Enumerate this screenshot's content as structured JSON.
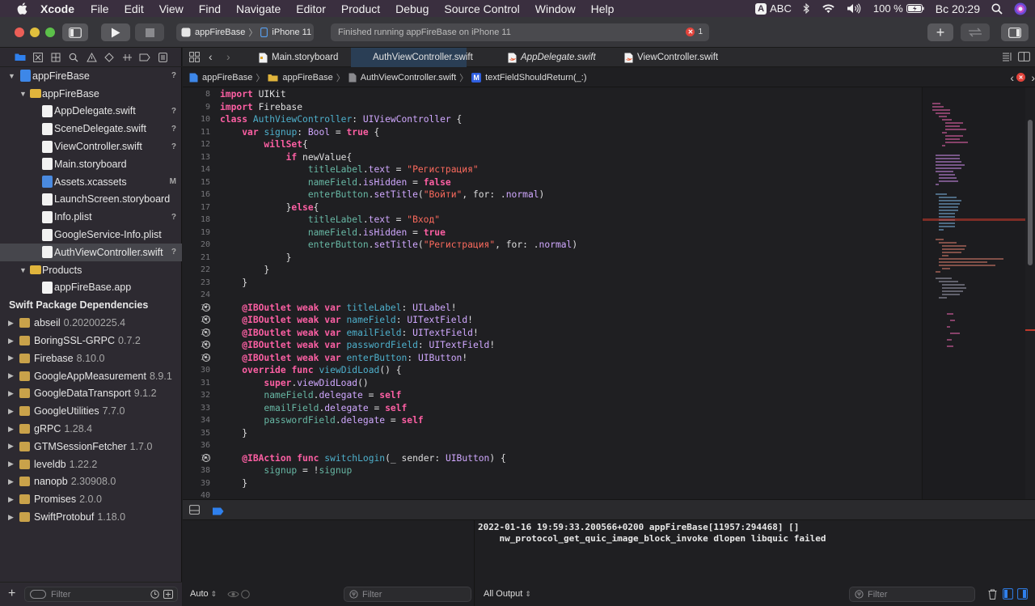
{
  "menubar": {
    "app": "Xcode",
    "items": [
      "File",
      "Edit",
      "View",
      "Find",
      "Navigate",
      "Editor",
      "Product",
      "Debug",
      "Source Control",
      "Window",
      "Help"
    ],
    "input_source": "ABC",
    "battery": "100 %",
    "clock": "Вс 20:29"
  },
  "toolbar": {
    "scheme": "appFireBase",
    "device": "iPhone 11",
    "status": "Finished running appFireBase on iPhone 11",
    "error_count": "1"
  },
  "navigator": {
    "tree": [
      {
        "label": "appFireBase",
        "level": 0,
        "type": "project",
        "status": "?",
        "expanded": true
      },
      {
        "label": "appFireBase",
        "level": 1,
        "type": "folder",
        "status": "",
        "expanded": true
      },
      {
        "label": "AppDelegate.swift",
        "level": 2,
        "type": "swift",
        "status": "?"
      },
      {
        "label": "SceneDelegate.swift",
        "level": 2,
        "type": "swift",
        "status": "?"
      },
      {
        "label": "ViewController.swift",
        "level": 2,
        "type": "swift",
        "status": "?"
      },
      {
        "label": "Main.storyboard",
        "level": 2,
        "type": "storyboard",
        "status": ""
      },
      {
        "label": "Assets.xcassets",
        "level": 2,
        "type": "assets",
        "status": "M"
      },
      {
        "label": "LaunchScreen.storyboard",
        "level": 2,
        "type": "storyboard",
        "status": ""
      },
      {
        "label": "Info.plist",
        "level": 2,
        "type": "plist",
        "status": "?"
      },
      {
        "label": "GoogleService-Info.plist",
        "level": 2,
        "type": "plist",
        "status": ""
      },
      {
        "label": "AuthViewController.swift",
        "level": 2,
        "type": "swift",
        "status": "?",
        "selected": true
      },
      {
        "label": "Products",
        "level": 1,
        "type": "folder",
        "status": "",
        "expanded": true
      },
      {
        "label": "appFireBase.app",
        "level": 2,
        "type": "app",
        "status": ""
      }
    ],
    "packages_header": "Swift Package Dependencies",
    "packages": [
      {
        "name": "abseil",
        "version": "0.20200225.4"
      },
      {
        "name": "BoringSSL-GRPC",
        "version": "0.7.2"
      },
      {
        "name": "Firebase",
        "version": "8.10.0"
      },
      {
        "name": "GoogleAppMeasurement",
        "version": "8.9.1"
      },
      {
        "name": "GoogleDataTransport",
        "version": "9.1.2"
      },
      {
        "name": "GoogleUtilities",
        "version": "7.7.0"
      },
      {
        "name": "gRPC",
        "version": "1.28.4"
      },
      {
        "name": "GTMSessionFetcher",
        "version": "1.7.0"
      },
      {
        "name": "leveldb",
        "version": "1.22.2"
      },
      {
        "name": "nanopb",
        "version": "2.30908.0"
      },
      {
        "name": "Promises",
        "version": "2.0.0"
      },
      {
        "name": "SwiftProtobuf",
        "version": "1.18.0"
      }
    ],
    "filter_placeholder": "Filter"
  },
  "tabs": [
    {
      "label": "Main.storyboard",
      "italic": false,
      "active": false
    },
    {
      "label": "AuthViewController.swift",
      "italic": false,
      "active": true
    },
    {
      "label": "AppDelegate.swift",
      "italic": true,
      "active": false
    },
    {
      "label": "ViewController.swift",
      "italic": false,
      "active": false
    }
  ],
  "jumpbar": {
    "project": "appFireBase",
    "group": "appFireBase",
    "file": "AuthViewController.swift",
    "symbol_badge": "M",
    "symbol": "textFieldShouldReturn(_:)"
  },
  "code": [
    {
      "n": "8",
      "o": false,
      "t": [
        [
          "kw",
          "import"
        ],
        [
          "pl",
          " UIKit"
        ]
      ]
    },
    {
      "n": "9",
      "o": false,
      "t": [
        [
          "kw",
          "import"
        ],
        [
          "pl",
          " Firebase"
        ]
      ]
    },
    {
      "n": "10",
      "o": false,
      "t": [
        [
          "kw",
          "class"
        ],
        [
          "pl",
          " "
        ],
        [
          "id",
          "AuthViewController"
        ],
        [
          "pl",
          ": "
        ],
        [
          "ty",
          "UIViewController"
        ],
        [
          "pl",
          " {"
        ]
      ]
    },
    {
      "n": "11",
      "o": false,
      "t": [
        [
          "pl",
          "    "
        ],
        [
          "kw",
          "var"
        ],
        [
          "pl",
          " "
        ],
        [
          "id",
          "signup"
        ],
        [
          "pl",
          ": "
        ],
        [
          "ty",
          "Bool"
        ],
        [
          "pl",
          " = "
        ],
        [
          "kw",
          "true"
        ],
        [
          "pl",
          " {"
        ]
      ]
    },
    {
      "n": "12",
      "o": false,
      "t": [
        [
          "pl",
          "        "
        ],
        [
          "kw",
          "willSet"
        ],
        [
          "pl",
          "{"
        ]
      ]
    },
    {
      "n": "13",
      "o": false,
      "t": [
        [
          "pl",
          "            "
        ],
        [
          "kw",
          "if"
        ],
        [
          "pl",
          " newValue{"
        ]
      ]
    },
    {
      "n": "14",
      "o": false,
      "t": [
        [
          "pl",
          "                "
        ],
        [
          "fn",
          "titleLabel"
        ],
        [
          "pl",
          "."
        ],
        [
          "ty",
          "text"
        ],
        [
          "pl",
          " = "
        ],
        [
          "st2",
          "\"Регистрация\""
        ]
      ]
    },
    {
      "n": "15",
      "o": false,
      "t": [
        [
          "pl",
          "                "
        ],
        [
          "fn",
          "nameField"
        ],
        [
          "pl",
          "."
        ],
        [
          "ty",
          "isHidden"
        ],
        [
          "pl",
          " = "
        ],
        [
          "kw",
          "false"
        ]
      ]
    },
    {
      "n": "16",
      "o": false,
      "t": [
        [
          "pl",
          "                "
        ],
        [
          "fn",
          "enterButton"
        ],
        [
          "pl",
          "."
        ],
        [
          "ty",
          "setTitle"
        ],
        [
          "pl",
          "("
        ],
        [
          "st2",
          "\"Войти\""
        ],
        [
          "pl",
          ", for: ."
        ],
        [
          "ty",
          "normal"
        ],
        [
          "pl",
          ")"
        ]
      ]
    },
    {
      "n": "17",
      "o": false,
      "t": [
        [
          "pl",
          "            }"
        ],
        [
          "kw",
          "else"
        ],
        [
          "pl",
          "{"
        ]
      ]
    },
    {
      "n": "18",
      "o": false,
      "t": [
        [
          "pl",
          "                "
        ],
        [
          "fn",
          "titleLabel"
        ],
        [
          "pl",
          "."
        ],
        [
          "ty",
          "text"
        ],
        [
          "pl",
          " = "
        ],
        [
          "st2",
          "\"Вход\""
        ]
      ]
    },
    {
      "n": "19",
      "o": false,
      "t": [
        [
          "pl",
          "                "
        ],
        [
          "fn",
          "nameField"
        ],
        [
          "pl",
          "."
        ],
        [
          "ty",
          "isHidden"
        ],
        [
          "pl",
          " = "
        ],
        [
          "kw",
          "true"
        ]
      ]
    },
    {
      "n": "20",
      "o": false,
      "t": [
        [
          "pl",
          "                "
        ],
        [
          "fn",
          "enterButton"
        ],
        [
          "pl",
          "."
        ],
        [
          "ty",
          "setTitle"
        ],
        [
          "pl",
          "("
        ],
        [
          "st2",
          "\"Регистрация\""
        ],
        [
          "pl",
          ", for: ."
        ],
        [
          "ty",
          "normal"
        ],
        [
          "pl",
          ")"
        ]
      ]
    },
    {
      "n": "21",
      "o": false,
      "t": [
        [
          "pl",
          "            }"
        ]
      ]
    },
    {
      "n": "22",
      "o": false,
      "t": [
        [
          "pl",
          "        }"
        ]
      ]
    },
    {
      "n": "23",
      "o": false,
      "t": [
        [
          "pl",
          "    }"
        ]
      ]
    },
    {
      "n": "24",
      "o": false,
      "t": [
        [
          "pl",
          ""
        ]
      ]
    },
    {
      "n": "25",
      "o": true,
      "t": [
        [
          "pl",
          "    "
        ],
        [
          "kw",
          "@IBOutlet"
        ],
        [
          "pl",
          " "
        ],
        [
          "kw",
          "weak"
        ],
        [
          "pl",
          " "
        ],
        [
          "kw",
          "var"
        ],
        [
          "pl",
          " "
        ],
        [
          "id",
          "titleLabel"
        ],
        [
          "pl",
          ": "
        ],
        [
          "ty",
          "UILabel"
        ],
        [
          "pl",
          "!"
        ]
      ]
    },
    {
      "n": "26",
      "o": true,
      "t": [
        [
          "pl",
          "    "
        ],
        [
          "kw",
          "@IBOutlet"
        ],
        [
          "pl",
          " "
        ],
        [
          "kw",
          "weak"
        ],
        [
          "pl",
          " "
        ],
        [
          "kw",
          "var"
        ],
        [
          "pl",
          " "
        ],
        [
          "id",
          "nameField"
        ],
        [
          "pl",
          ": "
        ],
        [
          "ty",
          "UITextField"
        ],
        [
          "pl",
          "!"
        ]
      ]
    },
    {
      "n": "27",
      "o": true,
      "t": [
        [
          "pl",
          "    "
        ],
        [
          "kw",
          "@IBOutlet"
        ],
        [
          "pl",
          " "
        ],
        [
          "kw",
          "weak"
        ],
        [
          "pl",
          " "
        ],
        [
          "kw",
          "var"
        ],
        [
          "pl",
          " "
        ],
        [
          "id",
          "emailField"
        ],
        [
          "pl",
          ": "
        ],
        [
          "ty",
          "UITextField"
        ],
        [
          "pl",
          "!"
        ]
      ]
    },
    {
      "n": "28",
      "o": true,
      "t": [
        [
          "pl",
          "    "
        ],
        [
          "kw",
          "@IBOutlet"
        ],
        [
          "pl",
          " "
        ],
        [
          "kw",
          "weak"
        ],
        [
          "pl",
          " "
        ],
        [
          "kw",
          "var"
        ],
        [
          "pl",
          " "
        ],
        [
          "id",
          "passwordField"
        ],
        [
          "pl",
          ": "
        ],
        [
          "ty",
          "UITextField"
        ],
        [
          "pl",
          "!"
        ]
      ]
    },
    {
      "n": "29",
      "o": true,
      "t": [
        [
          "pl",
          "    "
        ],
        [
          "kw",
          "@IBOutlet"
        ],
        [
          "pl",
          " "
        ],
        [
          "kw",
          "weak"
        ],
        [
          "pl",
          " "
        ],
        [
          "kw",
          "var"
        ],
        [
          "pl",
          " "
        ],
        [
          "id",
          "enterButton"
        ],
        [
          "pl",
          ": "
        ],
        [
          "ty",
          "UIButton"
        ],
        [
          "pl",
          "!"
        ]
      ]
    },
    {
      "n": "30",
      "o": false,
      "t": [
        [
          "pl",
          "    "
        ],
        [
          "kw",
          "override"
        ],
        [
          "pl",
          " "
        ],
        [
          "kw",
          "func"
        ],
        [
          "pl",
          " "
        ],
        [
          "id",
          "viewDidLoad"
        ],
        [
          "pl",
          "() {"
        ]
      ]
    },
    {
      "n": "31",
      "o": false,
      "t": [
        [
          "pl",
          "        "
        ],
        [
          "kw",
          "super"
        ],
        [
          "pl",
          "."
        ],
        [
          "ty",
          "viewDidLoad"
        ],
        [
          "pl",
          "()"
        ]
      ]
    },
    {
      "n": "32",
      "o": false,
      "t": [
        [
          "pl",
          "        "
        ],
        [
          "fn",
          "nameField"
        ],
        [
          "pl",
          "."
        ],
        [
          "ty",
          "delegate"
        ],
        [
          "pl",
          " = "
        ],
        [
          "kw",
          "self"
        ]
      ]
    },
    {
      "n": "33",
      "o": false,
      "t": [
        [
          "pl",
          "        "
        ],
        [
          "fn",
          "emailField"
        ],
        [
          "pl",
          "."
        ],
        [
          "ty",
          "delegate"
        ],
        [
          "pl",
          " = "
        ],
        [
          "kw",
          "self"
        ]
      ]
    },
    {
      "n": "34",
      "o": false,
      "t": [
        [
          "pl",
          "        "
        ],
        [
          "fn",
          "passwordField"
        ],
        [
          "pl",
          "."
        ],
        [
          "ty",
          "delegate"
        ],
        [
          "pl",
          " = "
        ],
        [
          "kw",
          "self"
        ]
      ]
    },
    {
      "n": "35",
      "o": false,
      "t": [
        [
          "pl",
          "    }"
        ]
      ]
    },
    {
      "n": "36",
      "o": false,
      "t": [
        [
          "pl",
          ""
        ]
      ]
    },
    {
      "n": "37",
      "o": true,
      "t": [
        [
          "pl",
          "    "
        ],
        [
          "kw",
          "@IBAction"
        ],
        [
          "pl",
          " "
        ],
        [
          "kw",
          "func"
        ],
        [
          "pl",
          " "
        ],
        [
          "id",
          "switchLogin"
        ],
        [
          "pl",
          "(_ sender: "
        ],
        [
          "ty",
          "UIButton"
        ],
        [
          "pl",
          ") {"
        ]
      ]
    },
    {
      "n": "38",
      "o": false,
      "t": [
        [
          "pl",
          "        "
        ],
        [
          "fn",
          "signup"
        ],
        [
          "pl",
          " = !"
        ],
        [
          "fn",
          "signup"
        ]
      ]
    },
    {
      "n": "39",
      "o": false,
      "t": [
        [
          "pl",
          "    }"
        ]
      ]
    },
    {
      "n": "40",
      "o": false,
      "t": [
        [
          "pl",
          ""
        ]
      ]
    }
  ],
  "debug": {
    "auto_label": "Auto",
    "filter_placeholder": "Filter",
    "output_label": "All Output",
    "console_text": "2022-01-16 19:59:33.200566+0200 appFireBase[11957:294468] []\n    nw_protocol_get_quic_image_block_invoke dlopen libquic failed"
  },
  "colors": {
    "accent": "#2a6fd6",
    "error": "#e2433b",
    "keyword": "#fc5fa3",
    "type": "#d0a8ff",
    "string": "#fc6a5d"
  }
}
